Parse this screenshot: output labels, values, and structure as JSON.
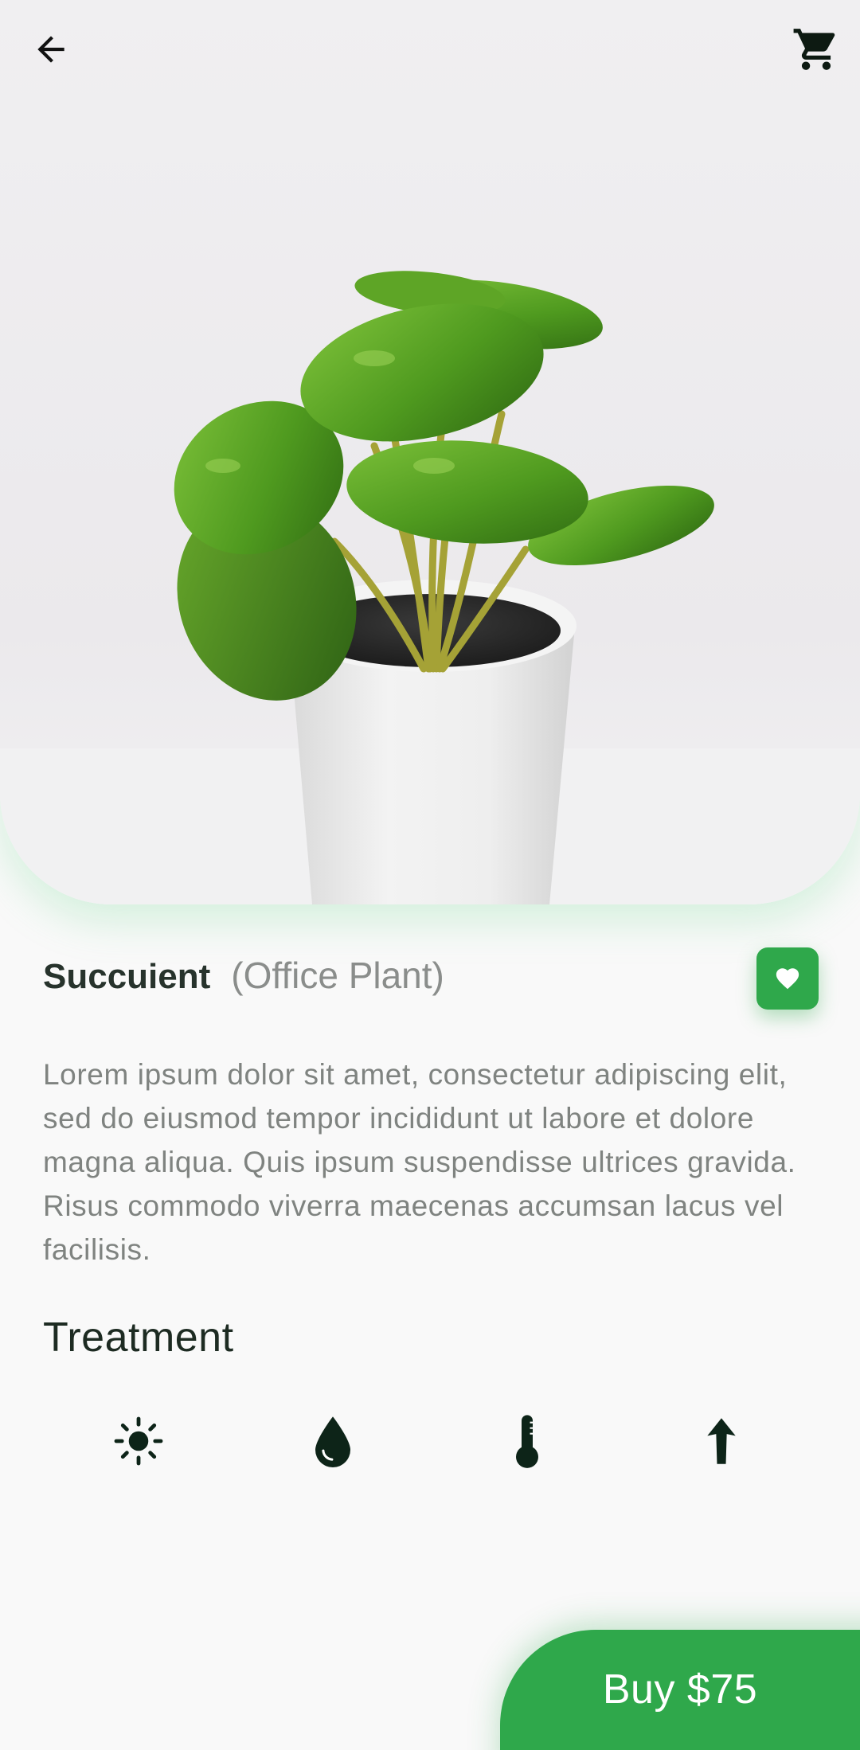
{
  "product": {
    "name": "Succuient",
    "category": "(Office Plant)",
    "description": "Lorem ipsum dolor sit amet, consectetur adipiscing elit, sed do eiusmod tempor incididunt ut labore et dolore magna aliqua. Quis ipsum suspendisse ultrices gravida. Risus commodo viverra maecenas accumsan lacus vel facilisis.",
    "image_subject": "potted pilea plant in white pot"
  },
  "header": {
    "back_icon": "arrow-left-icon",
    "cart_icon": "shopping-cart-icon"
  },
  "favorite": {
    "icon": "heart-icon"
  },
  "treatment": {
    "title": "Treatment",
    "icons": [
      "sun-icon",
      "water-drop-icon",
      "thermometer-icon",
      "arrow-up-icon"
    ]
  },
  "buy": {
    "label": "Buy $75"
  },
  "colors": {
    "accent": "#2fa84b",
    "dark_text": "#27332c",
    "muted_text": "#8a8d8b",
    "icon_dark": "#0d2418",
    "background": "#f9f9f9"
  }
}
